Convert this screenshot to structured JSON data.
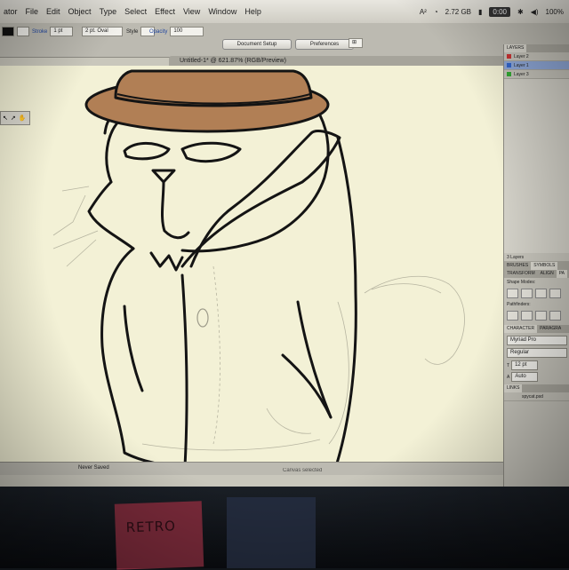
{
  "menubar": {
    "items": [
      "ator",
      "File",
      "Edit",
      "Object",
      "Type",
      "Select",
      "Effect",
      "View",
      "Window",
      "Help"
    ],
    "status": {
      "memory": "2.72 GB",
      "time": "0:00",
      "battery": "100%"
    }
  },
  "controlbar": {
    "stroke_label": "Stroke",
    "stroke_value": "1 pt",
    "brush_value": "2 pt. Oval",
    "style_label": "Style",
    "opacity_label": "Opacity",
    "opacity_value": "100",
    "document_setup": "Document Setup",
    "preferences": "Preferences"
  },
  "document": {
    "tab_title": "Untitled-1* @ 621.87% (RGB/Preview)"
  },
  "statusbar": {
    "save_state": "Never Saved",
    "selection": "Canvas selected"
  },
  "panels": {
    "layers": {
      "tab": "LAYERS",
      "items": [
        "Layer 2",
        "Layer 1",
        "Layer 3"
      ],
      "count": "3 Layers"
    },
    "brushes_tab": "BRUSHES",
    "symbols_tab": "SYMBOLS",
    "transform_tab": "TRANSFORM",
    "align_tab": "ALIGN",
    "pathfinder_tab": "PA",
    "shape_modes": "Shape Modes:",
    "pathfinders": "Pathfinders:",
    "character_tab": "CHARACTER",
    "paragraph_tab": "PARAGRA",
    "font": "Myriad Pro",
    "font_style": "Regular",
    "font_size": "12 pt",
    "leading": "Auto",
    "links_tab": "LINKS",
    "link_file": "spycat.psd"
  },
  "stickies": {
    "red_note": "RETRO"
  },
  "colors": {
    "hat_fill": "#b17f55",
    "canvas_bg": "#f3f1d6",
    "outline": "#141414",
    "layer_highlight": "#8fa8d8"
  }
}
